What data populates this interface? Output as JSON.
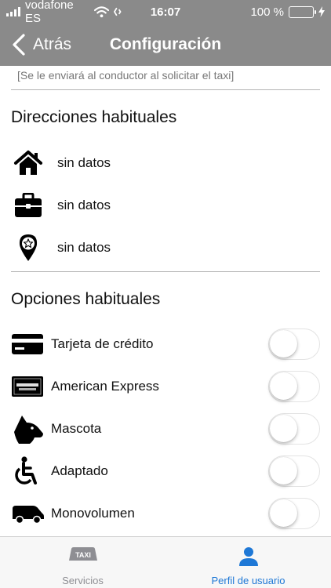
{
  "status_bar": {
    "carrier": "vodafone ES",
    "time": "16:07",
    "battery": "100 %",
    "battery_level": 1.0
  },
  "nav": {
    "back_label": "Atrás",
    "title": "Configuración"
  },
  "hint": "[Se le enviará al conductor al solicitar el taxi]",
  "addresses": {
    "title": "Direcciones habituales",
    "items": [
      {
        "icon": "home-icon",
        "label": "sin datos"
      },
      {
        "icon": "briefcase-icon",
        "label": "sin datos"
      },
      {
        "icon": "star-pin-icon",
        "label": "sin datos"
      }
    ]
  },
  "options": {
    "title": "Opciones habituales",
    "items": [
      {
        "icon": "credit-card-icon",
        "label": "Tarjeta de crédito",
        "enabled": false
      },
      {
        "icon": "american-express-icon",
        "label": "American Express",
        "enabled": false
      },
      {
        "icon": "dog-icon",
        "label": "Mascota",
        "enabled": false
      },
      {
        "icon": "wheelchair-icon",
        "label": "Adaptado",
        "enabled": false
      },
      {
        "icon": "van-icon",
        "label": "Monovolumen",
        "enabled": false
      }
    ]
  },
  "tabs": [
    {
      "label": "Servicios",
      "icon": "taxi-icon",
      "icon_text": "TAXI",
      "active": false
    },
    {
      "label": "Perfil de usuario",
      "icon": "user-icon",
      "active": true
    }
  ],
  "colors": {
    "header": "#8a8a8a",
    "active_tab": "#1e78d6",
    "inactive_tab": "#8e8e93",
    "battery": "#4cd964"
  }
}
